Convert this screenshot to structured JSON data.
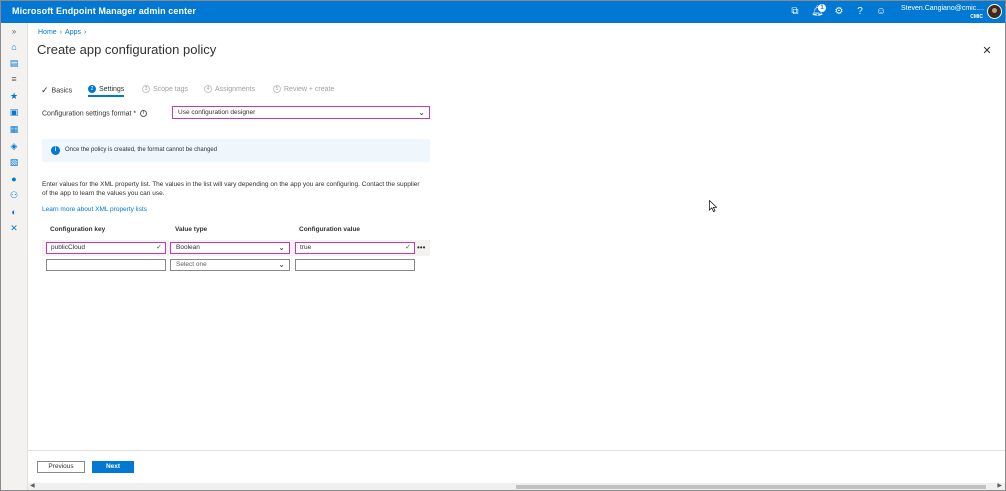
{
  "topbar": {
    "title": "Microsoft Endpoint Manager admin center",
    "notification_count": "1",
    "user_name": "Steven.Cangiano@cmic....",
    "user_org": "CMIC"
  },
  "breadcrumb": {
    "home": "Home",
    "apps": "Apps"
  },
  "page_title": "Create app configuration policy",
  "steps": [
    {
      "label": "Basics",
      "state": "done"
    },
    {
      "num": "2",
      "label": "Settings",
      "state": "current"
    },
    {
      "num": "3",
      "label": "Scope tags",
      "state": "pending"
    },
    {
      "num": "4",
      "label": "Assignments",
      "state": "pending"
    },
    {
      "num": "5",
      "label": "Review + create",
      "state": "pending"
    }
  ],
  "format": {
    "label": "Configuration settings format *",
    "value": "Use configuration designer"
  },
  "info_message": "Once the policy is created, the format cannot be changed",
  "description": "Enter values for the XML property list. The values in the list will vary depending on the app you are configuring. Contact the supplier of the app to learn the values you can use.",
  "learn_more": "Learn more about XML property lists",
  "table": {
    "headers": [
      "Configuration key",
      "Value type",
      "Configuration value"
    ],
    "rows": [
      {
        "key": "publicCloud",
        "type": "Boolean",
        "value": "true"
      },
      {
        "key": "",
        "type": "Select one",
        "value": ""
      }
    ]
  },
  "footer": {
    "previous": "Previous",
    "next": "Next"
  },
  "colors": {
    "brand": "#0078d4",
    "focus": "#c239b3"
  }
}
